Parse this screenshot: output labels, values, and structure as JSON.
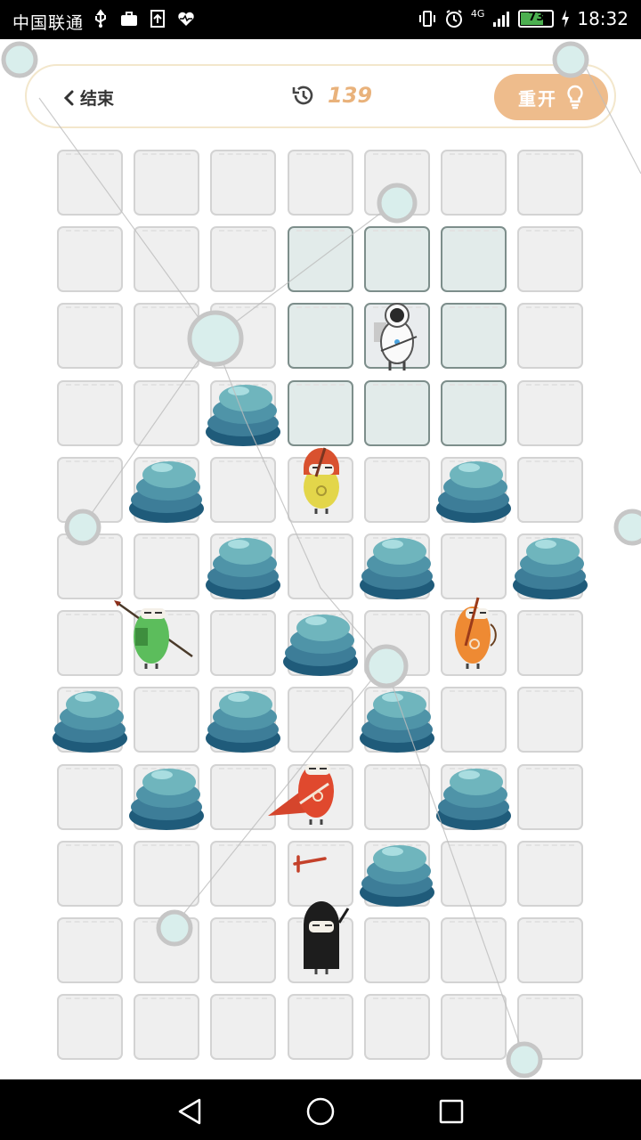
{
  "status_bar": {
    "carrier": "中国联通",
    "network": "4G",
    "battery": "73",
    "battery_level": 0.73,
    "time": "18:32",
    "icons": [
      "usb-icon",
      "briefcase-icon",
      "upload-icon",
      "heart-monitor-icon",
      "vibrate-icon",
      "alarm-icon",
      "signal-icon",
      "battery-icon",
      "charging-icon"
    ]
  },
  "header": {
    "back_label": "结束",
    "back_icon": "chevron-left-icon",
    "timer_icon": "history-icon",
    "timer_value": "139",
    "restart_label": "重开",
    "restart_icon": "lightbulb-icon"
  },
  "colors": {
    "accent": "#eebc8c",
    "timer": "#e9b27b",
    "tile": "#efefef",
    "tile_highlight": "#e2ebea",
    "rock_top": "#6fb5bd",
    "rock_bottom": "#1f5b7a"
  },
  "board": {
    "rows": 12,
    "cols": 7,
    "highlighted_cells": [
      [
        1,
        3
      ],
      [
        1,
        4
      ],
      [
        1,
        5
      ],
      [
        2,
        3
      ],
      [
        2,
        5
      ],
      [
        3,
        3
      ],
      [
        3,
        4
      ],
      [
        3,
        5
      ]
    ],
    "selected_cell": [
      2,
      4
    ],
    "rocks": [
      [
        3,
        2
      ],
      [
        4,
        1
      ],
      [
        4,
        5
      ],
      [
        5,
        2
      ],
      [
        5,
        4
      ],
      [
        5,
        6
      ],
      [
        6,
        3
      ],
      [
        7,
        0
      ],
      [
        7,
        2
      ],
      [
        7,
        4
      ],
      [
        8,
        1
      ],
      [
        8,
        5
      ],
      [
        9,
        4
      ]
    ],
    "pieces": [
      {
        "name": "astronaut",
        "row": 2,
        "col": 4,
        "icon": "astronaut-icon"
      },
      {
        "name": "yellow-warrior",
        "row": 4,
        "col": 3,
        "icon": "yellow-hooded-warrior-icon"
      },
      {
        "name": "green-spearman",
        "row": 6,
        "col": 1,
        "icon": "green-spearman-icon"
      },
      {
        "name": "orange-archer",
        "row": 6,
        "col": 5,
        "icon": "orange-archer-icon"
      },
      {
        "name": "red-caped-warrior",
        "row": 8,
        "col": 3,
        "icon": "red-caped-warrior-icon"
      },
      {
        "name": "dropped-sword",
        "row": 9,
        "col": 3,
        "icon": "sword-icon"
      },
      {
        "name": "black-ninja",
        "row": 10,
        "col": 3,
        "icon": "black-ninja-icon"
      }
    ]
  },
  "nav": {
    "back_icon": "nav-back-icon",
    "home_icon": "nav-home-icon",
    "recents_icon": "nav-recents-icon"
  }
}
